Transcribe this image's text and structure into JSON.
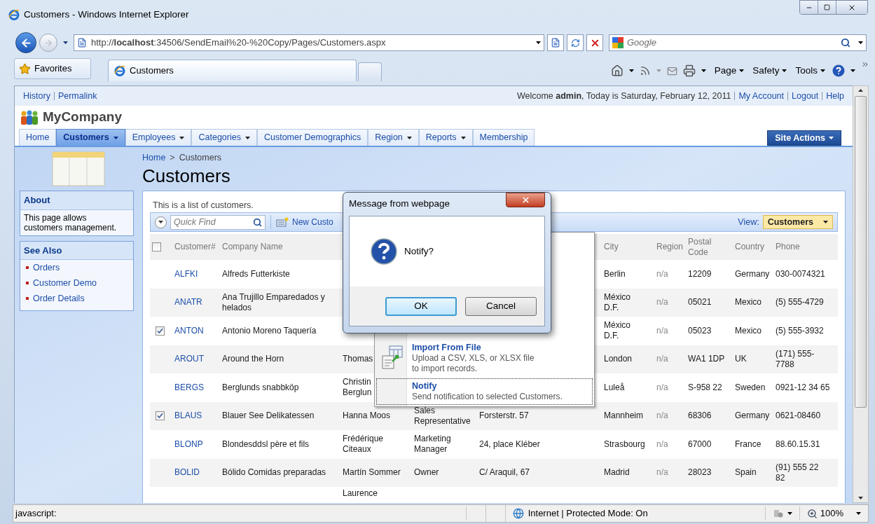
{
  "window": {
    "title": "Customers - Windows Internet Explorer"
  },
  "address_bar": {
    "url": "http://**localhost**:34506/SendEmail%20-%20Copy/Pages/Customers.aspx"
  },
  "search": {
    "placeholder": "Google"
  },
  "favorites": "Favorites",
  "tabs": [
    {
      "label": "Customers",
      "selected": true
    }
  ],
  "command_bar": [
    "Page",
    "Safety",
    "Tools"
  ],
  "page": {
    "top_links": [
      "History",
      "Permalink"
    ],
    "welcome": "Welcome **admin**, Today is Saturday, February 12, 2011",
    "account_links": [
      "My Account",
      "Logout",
      "Help"
    ],
    "brand": "MyCompany",
    "menu": [
      {
        "label": "Home",
        "selected": false,
        "dropdown": false
      },
      {
        "label": "Customers",
        "selected": true,
        "dropdown": true
      },
      {
        "label": "Employees",
        "selected": false,
        "dropdown": true
      },
      {
        "label": "Categories",
        "selected": false,
        "dropdown": true
      },
      {
        "label": "Customer Demographics",
        "selected": false,
        "dropdown": false
      },
      {
        "label": "Region",
        "selected": false,
        "dropdown": true
      },
      {
        "label": "Reports",
        "selected": false,
        "dropdown": true
      },
      {
        "label": "Membership",
        "selected": false,
        "dropdown": false
      }
    ],
    "site_actions": "Site Actions",
    "breadcrumb": {
      "items": [
        "Home",
        "Customers"
      ],
      "separator": ">"
    },
    "title": "Customers",
    "sidebar": {
      "about": {
        "title": "About",
        "text": "This page allows\ncustomers management."
      },
      "see_also": {
        "title": "See Also",
        "links": [
          "Orders",
          "Customer Demo",
          "Order Details"
        ]
      }
    },
    "description": "This is a list of customers.",
    "quick_find": {
      "placeholder": "Quick Find"
    },
    "toolbar_action": "New Custo",
    "view": {
      "label": "View:",
      "value": "Customers"
    },
    "columns": {
      "customer": "Customer#",
      "company": "Company Name",
      "city": "City",
      "region": "Region",
      "postal_code": "Postal\nCode",
      "country": "Country",
      "phone": "Phone"
    },
    "header_checked": false,
    "rows": [
      {
        "checked": false,
        "customer": "ALFKI",
        "company": "Alfreds Futterkiste",
        "city": "Berlin",
        "region": "n/a",
        "postal_code": "12209",
        "country": "Germany",
        "phone": "030-0074321"
      },
      {
        "checked": false,
        "customer": "ANATR",
        "company": "Ana Trujillo Emparedados y\nhelados",
        "city": "México\nD.F.",
        "region": "n/a",
        "postal_code": "05021",
        "country": "Mexico",
        "phone": "(5) 555-4729"
      },
      {
        "checked": true,
        "customer": "ANTON",
        "company": "Antonio Moreno Taquería",
        "city": "México\nD.F.",
        "region": "n/a",
        "postal_code": "05023",
        "country": "Mexico",
        "phone": "(5) 555-3932"
      },
      {
        "checked": false,
        "customer": "AROUT",
        "company": "Around the Horn",
        "contact": "Thomas",
        "city": "London",
        "region": "n/a",
        "postal_code": "WA1 1DP",
        "country": "UK",
        "phone": "(171) 555-\n7788"
      },
      {
        "checked": false,
        "customer": "BERGS",
        "company": "Berglunds snabbköp",
        "contact": "Christin\nBerglun",
        "city": "Luleå",
        "region": "n/a",
        "postal_code": "S-958 22",
        "country": "Sweden",
        "phone": "0921-12 34 65"
      },
      {
        "checked": true,
        "customer": "BLAUS",
        "company": "Blauer See Delikatessen",
        "contact": "Hanna Moos",
        "title": "Sales\nRepresentative",
        "address": "Forsterstr. 57",
        "city": "Mannheim",
        "region": "n/a",
        "postal_code": "68306",
        "country": "Germany",
        "phone": "0621-08460"
      },
      {
        "checked": false,
        "customer": "BLONP",
        "company": "Blondesddsl père et fils",
        "contact": "Frédérique\nCiteaux",
        "title": "Marketing Manager",
        "address": "24, place Kléber",
        "city": "Strasbourg",
        "region": "n/a",
        "postal_code": "67000",
        "country": "France",
        "phone": "88.60.15.31"
      },
      {
        "checked": false,
        "customer": "BOLID",
        "company": "Bólido Comidas preparadas",
        "contact": "Martín Sommer",
        "title": "Owner",
        "address": "C/ Araquil, 67",
        "city": "Madrid",
        "region": "n/a",
        "postal_code": "28023",
        "country": "Spain",
        "phone": "(91) 555 22\n82"
      },
      {
        "checked": false,
        "contact": "Laurence"
      }
    ],
    "context_menu": [
      {
        "title": "Import From File",
        "description": "Upload a CSV, XLS, or XLSX file\nto import records.",
        "focused": false
      },
      {
        "title": "Notify",
        "description": "Send notification to selected Customers.",
        "focused": true
      }
    ]
  },
  "dialog": {
    "title": "Message from webpage",
    "message": "Notify?",
    "buttons": [
      {
        "label": "OK",
        "default": true
      },
      {
        "label": "Cancel",
        "default": false
      }
    ]
  },
  "status_bar": {
    "text": "javascript:",
    "zone": "Internet | Protected Mode: On",
    "zoom": "100%"
  }
}
